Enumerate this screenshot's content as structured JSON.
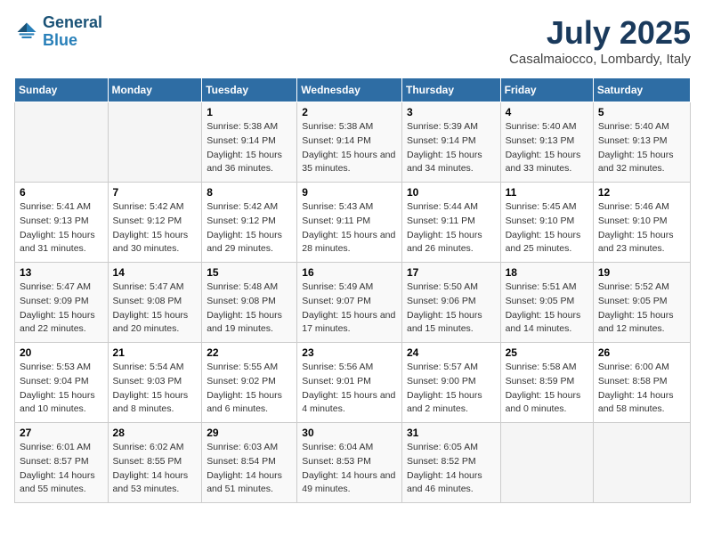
{
  "header": {
    "logo_line1": "General",
    "logo_line2": "Blue",
    "month": "July 2025",
    "location": "Casalmaiocco, Lombardy, Italy"
  },
  "weekdays": [
    "Sunday",
    "Monday",
    "Tuesday",
    "Wednesday",
    "Thursday",
    "Friday",
    "Saturday"
  ],
  "weeks": [
    [
      {
        "day": "",
        "info": ""
      },
      {
        "day": "",
        "info": ""
      },
      {
        "day": "1",
        "info": "Sunrise: 5:38 AM\nSunset: 9:14 PM\nDaylight: 15 hours and 36 minutes."
      },
      {
        "day": "2",
        "info": "Sunrise: 5:38 AM\nSunset: 9:14 PM\nDaylight: 15 hours and 35 minutes."
      },
      {
        "day": "3",
        "info": "Sunrise: 5:39 AM\nSunset: 9:14 PM\nDaylight: 15 hours and 34 minutes."
      },
      {
        "day": "4",
        "info": "Sunrise: 5:40 AM\nSunset: 9:13 PM\nDaylight: 15 hours and 33 minutes."
      },
      {
        "day": "5",
        "info": "Sunrise: 5:40 AM\nSunset: 9:13 PM\nDaylight: 15 hours and 32 minutes."
      }
    ],
    [
      {
        "day": "6",
        "info": "Sunrise: 5:41 AM\nSunset: 9:13 PM\nDaylight: 15 hours and 31 minutes."
      },
      {
        "day": "7",
        "info": "Sunrise: 5:42 AM\nSunset: 9:12 PM\nDaylight: 15 hours and 30 minutes."
      },
      {
        "day": "8",
        "info": "Sunrise: 5:42 AM\nSunset: 9:12 PM\nDaylight: 15 hours and 29 minutes."
      },
      {
        "day": "9",
        "info": "Sunrise: 5:43 AM\nSunset: 9:11 PM\nDaylight: 15 hours and 28 minutes."
      },
      {
        "day": "10",
        "info": "Sunrise: 5:44 AM\nSunset: 9:11 PM\nDaylight: 15 hours and 26 minutes."
      },
      {
        "day": "11",
        "info": "Sunrise: 5:45 AM\nSunset: 9:10 PM\nDaylight: 15 hours and 25 minutes."
      },
      {
        "day": "12",
        "info": "Sunrise: 5:46 AM\nSunset: 9:10 PM\nDaylight: 15 hours and 23 minutes."
      }
    ],
    [
      {
        "day": "13",
        "info": "Sunrise: 5:47 AM\nSunset: 9:09 PM\nDaylight: 15 hours and 22 minutes."
      },
      {
        "day": "14",
        "info": "Sunrise: 5:47 AM\nSunset: 9:08 PM\nDaylight: 15 hours and 20 minutes."
      },
      {
        "day": "15",
        "info": "Sunrise: 5:48 AM\nSunset: 9:08 PM\nDaylight: 15 hours and 19 minutes."
      },
      {
        "day": "16",
        "info": "Sunrise: 5:49 AM\nSunset: 9:07 PM\nDaylight: 15 hours and 17 minutes."
      },
      {
        "day": "17",
        "info": "Sunrise: 5:50 AM\nSunset: 9:06 PM\nDaylight: 15 hours and 15 minutes."
      },
      {
        "day": "18",
        "info": "Sunrise: 5:51 AM\nSunset: 9:05 PM\nDaylight: 15 hours and 14 minutes."
      },
      {
        "day": "19",
        "info": "Sunrise: 5:52 AM\nSunset: 9:05 PM\nDaylight: 15 hours and 12 minutes."
      }
    ],
    [
      {
        "day": "20",
        "info": "Sunrise: 5:53 AM\nSunset: 9:04 PM\nDaylight: 15 hours and 10 minutes."
      },
      {
        "day": "21",
        "info": "Sunrise: 5:54 AM\nSunset: 9:03 PM\nDaylight: 15 hours and 8 minutes."
      },
      {
        "day": "22",
        "info": "Sunrise: 5:55 AM\nSunset: 9:02 PM\nDaylight: 15 hours and 6 minutes."
      },
      {
        "day": "23",
        "info": "Sunrise: 5:56 AM\nSunset: 9:01 PM\nDaylight: 15 hours and 4 minutes."
      },
      {
        "day": "24",
        "info": "Sunrise: 5:57 AM\nSunset: 9:00 PM\nDaylight: 15 hours and 2 minutes."
      },
      {
        "day": "25",
        "info": "Sunrise: 5:58 AM\nSunset: 8:59 PM\nDaylight: 15 hours and 0 minutes."
      },
      {
        "day": "26",
        "info": "Sunrise: 6:00 AM\nSunset: 8:58 PM\nDaylight: 14 hours and 58 minutes."
      }
    ],
    [
      {
        "day": "27",
        "info": "Sunrise: 6:01 AM\nSunset: 8:57 PM\nDaylight: 14 hours and 55 minutes."
      },
      {
        "day": "28",
        "info": "Sunrise: 6:02 AM\nSunset: 8:55 PM\nDaylight: 14 hours and 53 minutes."
      },
      {
        "day": "29",
        "info": "Sunrise: 6:03 AM\nSunset: 8:54 PM\nDaylight: 14 hours and 51 minutes."
      },
      {
        "day": "30",
        "info": "Sunrise: 6:04 AM\nSunset: 8:53 PM\nDaylight: 14 hours and 49 minutes."
      },
      {
        "day": "31",
        "info": "Sunrise: 6:05 AM\nSunset: 8:52 PM\nDaylight: 14 hours and 46 minutes."
      },
      {
        "day": "",
        "info": ""
      },
      {
        "day": "",
        "info": ""
      }
    ]
  ]
}
